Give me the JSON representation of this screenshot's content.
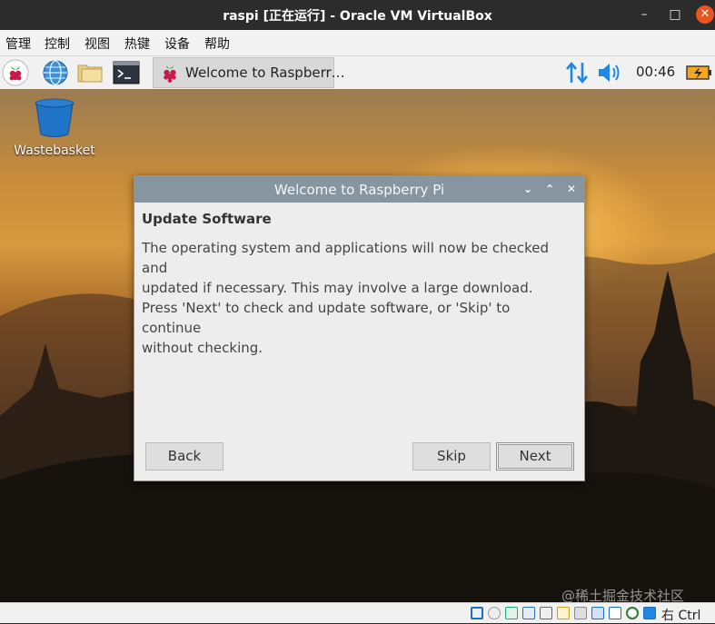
{
  "window": {
    "title": "raspi [正在运行] - Oracle VM VirtualBox"
  },
  "menu": {
    "items": [
      "管理",
      "控制",
      "视图",
      "热键",
      "设备",
      "帮助"
    ]
  },
  "taskbar": {
    "task_label": "Welcome to Raspberr…",
    "clock": "00:46"
  },
  "desktop": {
    "wastebasket_label": "Wastebasket"
  },
  "dialog": {
    "title": "Welcome to Raspberry Pi",
    "heading": "Update Software",
    "paragraph1_line1": "The operating system and applications will now be checked and",
    "paragraph1_line2": "updated if necessary. This may involve a large download.",
    "paragraph2_line1": "Press 'Next' to check and update software, or 'Skip' to continue",
    "paragraph2_line2": "without checking.",
    "back_label": "Back",
    "skip_label": "Skip",
    "next_label": "Next"
  },
  "statusbar": {
    "host_key": "右 Ctrl"
  },
  "watermark": "@稀土掘金技术社区",
  "colors": {
    "accent_close": "#e95420",
    "dialog_titlebar": "#8795a1"
  }
}
